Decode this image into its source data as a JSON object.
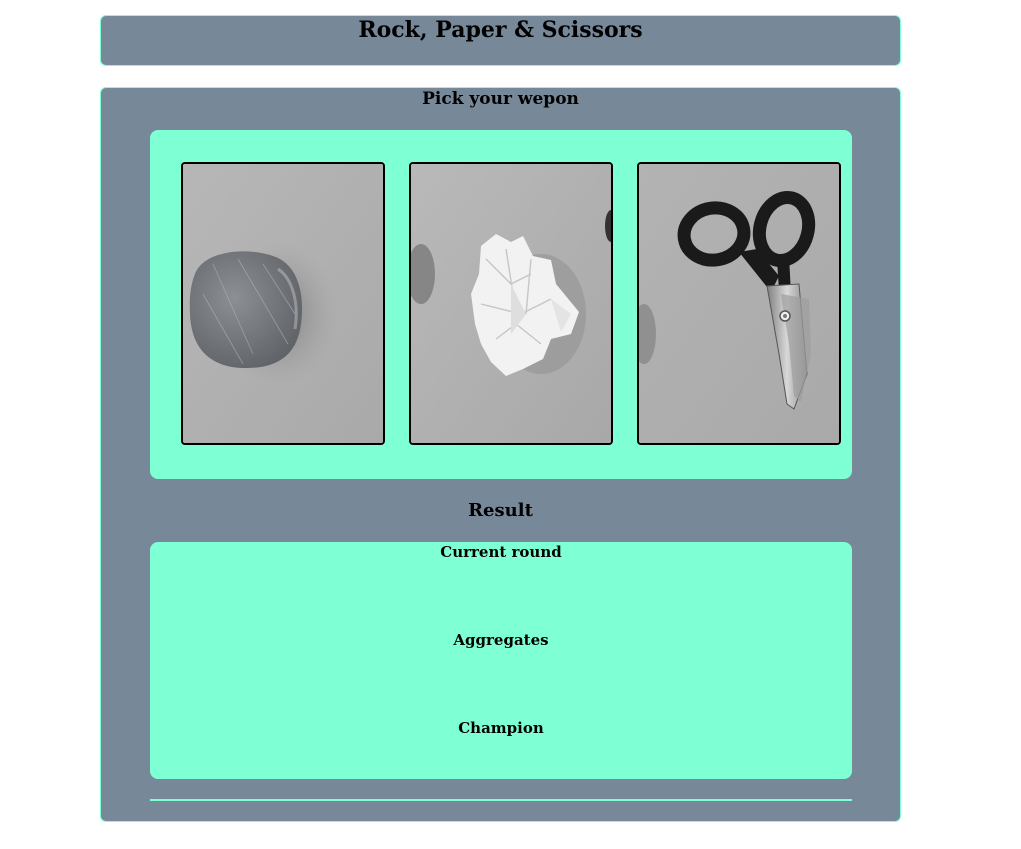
{
  "header": {
    "title": "Rock, Paper & Scissors"
  },
  "game": {
    "pick_heading": "Pick your wepon",
    "weapons": [
      {
        "name": "rock",
        "icon": "rock-image"
      },
      {
        "name": "paper",
        "icon": "crumpled-paper-image"
      },
      {
        "name": "scissors",
        "icon": "scissors-image"
      }
    ]
  },
  "result": {
    "heading": "Result",
    "current_round_label": "Current round",
    "aggregates_label": "Aggregates",
    "champion_label": "Champion"
  },
  "colors": {
    "panel": "#778899",
    "accent": "#7fffd4",
    "photo_background": "#b9b9b9"
  }
}
